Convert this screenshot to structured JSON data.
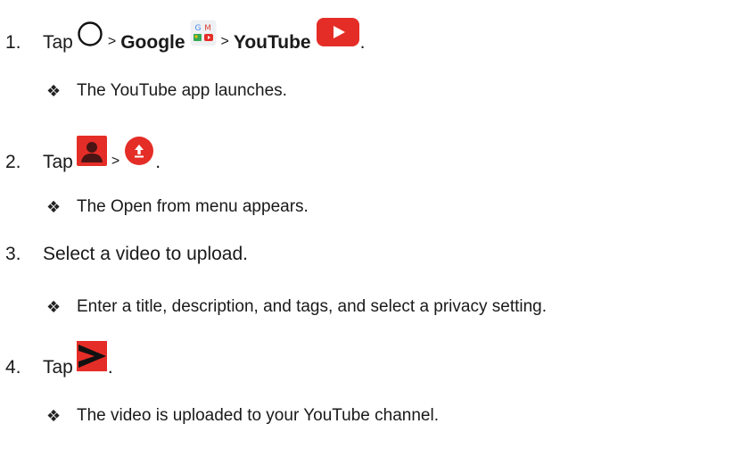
{
  "steps": [
    {
      "number": "1.",
      "tap": "Tap",
      "sep1": ">",
      "google": "Google",
      "sep2": ">",
      "youtube": "YouTube",
      "end": ".",
      "note": "The YouTube app launches."
    },
    {
      "number": "2.",
      "tap": "Tap",
      "sep1": ">",
      "end": ".",
      "note": "The Open from menu appears."
    },
    {
      "number": "3.",
      "text": "Select a video to upload.",
      "note": "Enter a title, description, and tags, and select a privacy setting."
    },
    {
      "number": "4.",
      "tap": "Tap",
      "end": ".",
      "note": "The video is uploaded to your YouTube channel."
    }
  ],
  "bullet_glyph": "❖",
  "icons": {
    "home": "home-circle-icon",
    "google_folder": "google-folder-icon",
    "youtube": "youtube-icon",
    "account": "account-icon",
    "upload": "upload-icon",
    "send": "send-icon"
  },
  "colors": {
    "youtube_red": "#e52d27",
    "text": "#1a1a1a"
  }
}
